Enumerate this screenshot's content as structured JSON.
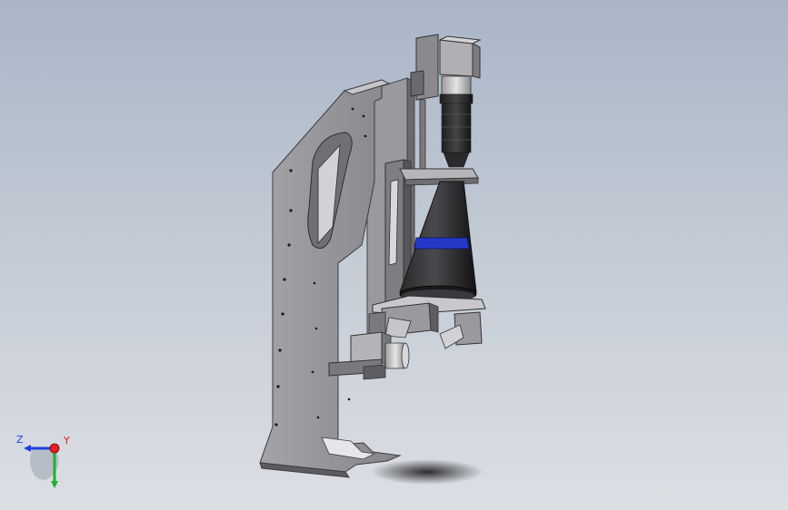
{
  "triad": {
    "x_label": "",
    "y_label": "Y",
    "z_label": "Z",
    "y_color": "#e02020",
    "z_color": "#2040e0",
    "x_color": "#20b030"
  },
  "colors": {
    "plate": "#8d8d8f",
    "plate_dark": "#5e5e62",
    "plate_light": "#c4c4c8",
    "lens_black": "#1c1c1e",
    "lens_band": "#2438c8",
    "camera_body": "#a8a8aa"
  }
}
